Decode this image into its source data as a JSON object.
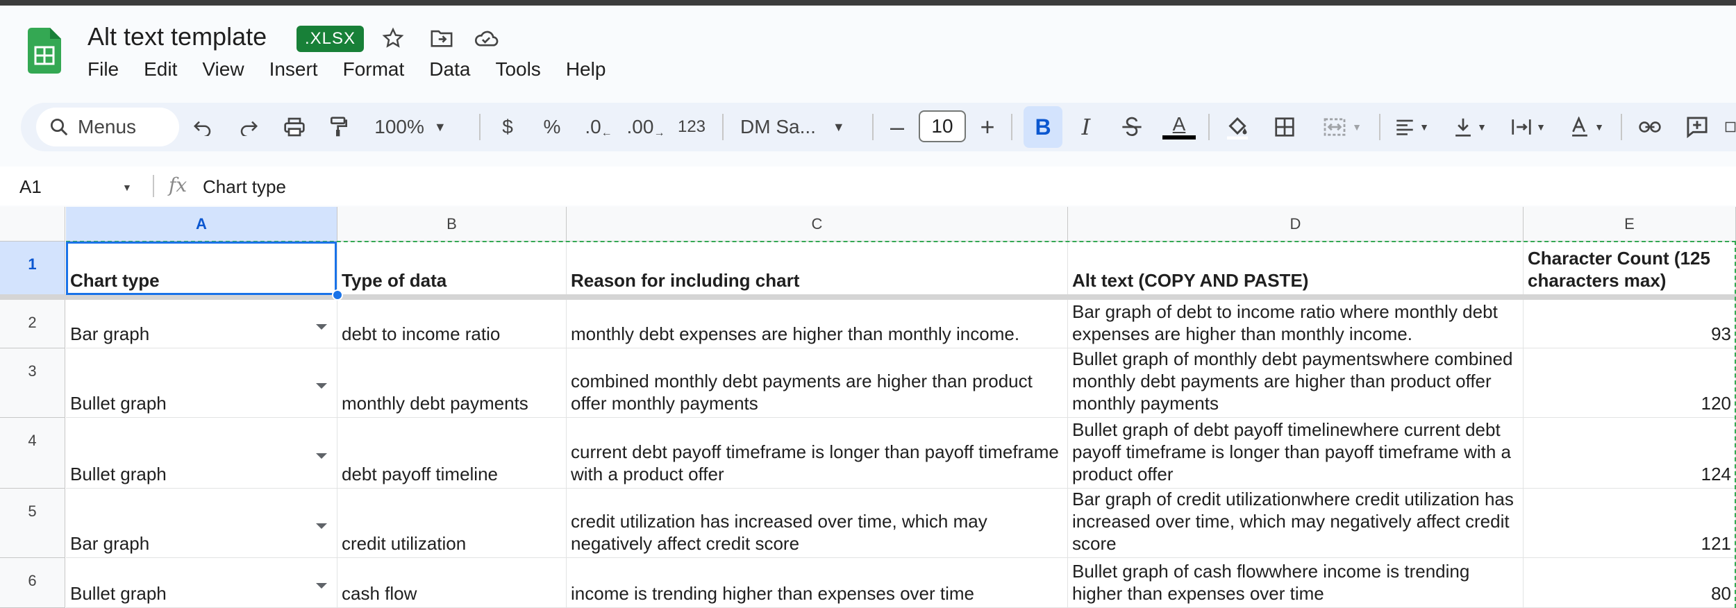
{
  "app": {
    "title": "Alt text template",
    "badge": ".XLSX",
    "menus": [
      "File",
      "Edit",
      "View",
      "Insert",
      "Format",
      "Data",
      "Tools",
      "Help"
    ]
  },
  "toolbar": {
    "search_label": "Menus",
    "zoom": "100%",
    "currency": "$",
    "percent": "%",
    "dec_decrease": ".0",
    "dec_increase": ".00",
    "number_format": "123",
    "font": "DM Sa...",
    "font_size": "10",
    "bold": "B",
    "italic": "I",
    "text_color_glyph": "A"
  },
  "formula_bar": {
    "cell_ref": "A1",
    "fx": "fx",
    "content": "Chart type"
  },
  "grid": {
    "columns": [
      "A",
      "B",
      "C",
      "D",
      "E"
    ],
    "rows": [
      {
        "num": "1",
        "a": "Chart type",
        "b": "Type of data",
        "c": "Reason for including chart",
        "d": "Alt text (COPY AND PASTE)",
        "e": "Character Count (125 characters max)"
      },
      {
        "num": "2",
        "a": "Bar graph",
        "b": "debt to income ratio",
        "c": "monthly debt expenses are higher than monthly income.",
        "d": "Bar graph of debt to income ratio where monthly debt expenses are higher than monthly income.",
        "e": "93"
      },
      {
        "num": "3",
        "a": "Bullet graph",
        "b": "monthly debt payments",
        "c": "combined monthly debt payments are higher than product offer monthly payments",
        "d": "Bullet graph of monthly debt paymentswhere combined monthly debt payments are higher than product offer monthly payments",
        "e": "120"
      },
      {
        "num": "4",
        "a": "Bullet graph",
        "b": "debt payoff timeline",
        "c": "current debt payoff timeframe is longer than payoff timeframe with a product offer",
        "d": "Bullet graph of debt payoff timelinewhere current debt payoff timeframe is longer than payoff timeframe with a product offer",
        "e": "124"
      },
      {
        "num": "5",
        "a": "Bar graph",
        "b": "credit utilization",
        "c": "credit utilization has increased over time, which may negatively affect credit score",
        "d": "Bar graph of credit utilizationwhere credit utilization has increased over time, which may negatively affect credit score",
        "e": "121"
      },
      {
        "num": "6",
        "a": "Bullet graph",
        "b": "cash flow",
        "c": "income is trending higher than expenses over time",
        "d": "Bullet graph of cash flowwhere income is trending higher than expenses over time",
        "e": "80"
      }
    ]
  },
  "colors": {
    "badge": "#188038",
    "selection": "#1a73e8",
    "toolbar_bg": "#edf2fa",
    "bold_active": "#d3e3fd"
  }
}
